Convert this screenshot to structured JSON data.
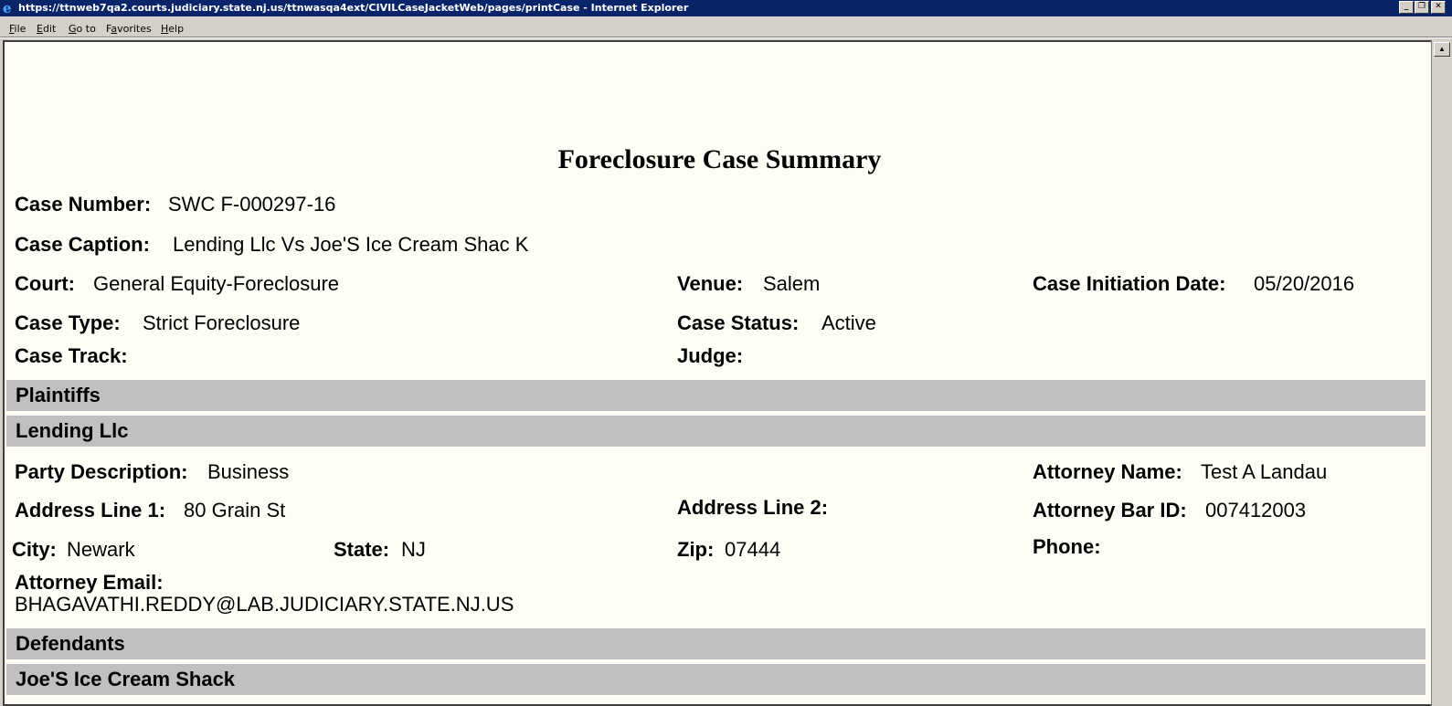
{
  "window": {
    "title": "https://ttnweb7qa2.courts.judiciary.state.nj.us/ttnwasqa4ext/CIVILCaseJacketWeb/pages/printCase - Internet Explorer"
  },
  "menu": [
    {
      "prefix": "",
      "key": "F",
      "rest": "ile"
    },
    {
      "prefix": "",
      "key": "E",
      "rest": "dit"
    },
    {
      "prefix": "",
      "key": "G",
      "rest": "o to"
    },
    {
      "prefix": "F",
      "key": "a",
      "rest": "vorites"
    },
    {
      "prefix": "",
      "key": "H",
      "rest": "elp"
    }
  ],
  "page": {
    "title": "Foreclosure Case Summary",
    "case_number": {
      "label": "Case Number:",
      "value": "SWC F-000297-16"
    },
    "case_caption": {
      "label": "Case Caption:",
      "value": "Lending Llc Vs Joe'S Ice Cream Shac K"
    },
    "court": {
      "label": "Court:",
      "value": "General Equity-Foreclosure"
    },
    "venue": {
      "label": "Venue:",
      "value": "Salem"
    },
    "initiation_date": {
      "label": "Case Initiation Date:",
      "value": "05/20/2016"
    },
    "case_type": {
      "label": "Case Type:",
      "value": "Strict Foreclosure"
    },
    "case_status": {
      "label": "Case Status:",
      "value": "Active"
    },
    "case_track": {
      "label": "Case Track:",
      "value": ""
    },
    "judge": {
      "label": "Judge:",
      "value": ""
    }
  },
  "plaintiffs": {
    "heading": "Plaintiffs",
    "party_name": "Lending Llc",
    "party_description": {
      "label": "Party Description:",
      "value": "Business"
    },
    "attorney_name": {
      "label": "Attorney Name:",
      "value": "Test A Landau"
    },
    "address_line_1": {
      "label": "Address Line 1:",
      "value": "80 Grain St"
    },
    "address_line_2": {
      "label": "Address Line 2:",
      "value": ""
    },
    "attorney_bar_id": {
      "label": "Attorney Bar ID:",
      "value": "007412003"
    },
    "city": {
      "label": "City:",
      "value": "Newark"
    },
    "state": {
      "label": "State:",
      "value": "NJ"
    },
    "zip": {
      "label": "Zip:",
      "value": "07444"
    },
    "phone": {
      "label": "Phone:",
      "value": ""
    },
    "attorney_email": {
      "label": "Attorney Email:",
      "value": "BHAGAVATHI.REDDY@LAB.JUDICIARY.STATE.NJ.US"
    }
  },
  "defendants": {
    "heading": "Defendants",
    "party_name": "Joe'S Ice Cream Shack"
  }
}
